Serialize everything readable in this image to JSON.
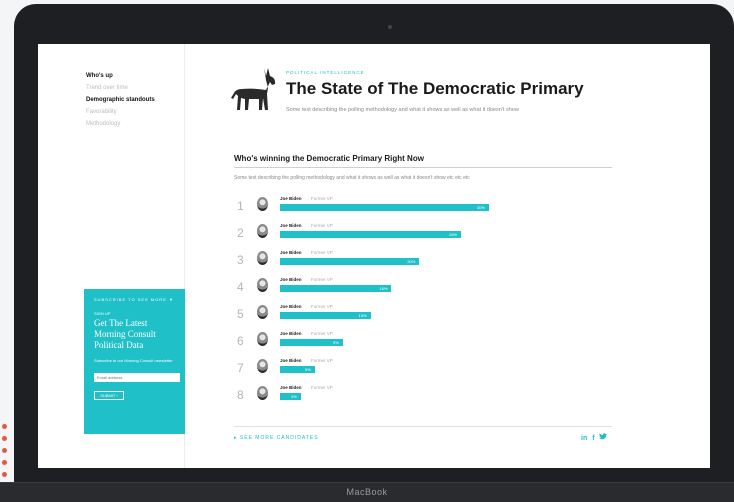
{
  "device": {
    "brand_label": "MacBook"
  },
  "sidebar": {
    "nav_items": [
      {
        "label": "Who's up",
        "active": true
      },
      {
        "label": "Trend over time",
        "active": false
      },
      {
        "label": "Demographic standouts",
        "active": true
      },
      {
        "label": "Favorability",
        "active": false
      },
      {
        "label": "Methodology",
        "active": false
      }
    ],
    "promo": {
      "heading": "SUBSCRIBE TO SEE MORE ▼",
      "kicker": "SIGN UP",
      "title": "Get The Latest Morning Consult Political Data",
      "hint": "Subscribe to our Morning Consult newsletter",
      "input_placeholder": "Email address",
      "button_label": "SUBMIT ›"
    }
  },
  "header": {
    "eyebrow": "POLITICAL INTELLIGENCE",
    "title": "The State of The Democratic Primary",
    "subtitle": "Some text describing the polling methodology and what it shows as well as what it doesn't show",
    "icon": "donkey-icon"
  },
  "section": {
    "title": "Who's winning the Democratic Primary Right Now",
    "description": "Some text describing the polling methodology and what it shows as well as what it doesn't show etc etc etc"
  },
  "accent_color": "#1fc0c7",
  "chart_data": {
    "type": "bar",
    "orientation": "horizontal",
    "categories": [
      "Joe Biden",
      "Joe Biden",
      "Joe Biden",
      "Joe Biden",
      "Joe Biden",
      "Joe Biden",
      "Joe Biden",
      "Joe Biden"
    ],
    "candidates": [
      {
        "rank": "1",
        "name": "Joe Biden",
        "role": "Former VP",
        "value": 30,
        "label": "30%"
      },
      {
        "rank": "2",
        "name": "Joe Biden",
        "role": "Former VP",
        "value": 26,
        "label": "26%"
      },
      {
        "rank": "3",
        "name": "Joe Biden",
        "role": "Former VP",
        "value": 20,
        "label": "20%"
      },
      {
        "rank": "4",
        "name": "Joe Biden",
        "role": "Former VP",
        "value": 16,
        "label": "16%"
      },
      {
        "rank": "5",
        "name": "Joe Biden",
        "role": "Former VP",
        "value": 13,
        "label": "13%"
      },
      {
        "rank": "6",
        "name": "Joe Biden",
        "role": "Former VP",
        "value": 9,
        "label": "9%"
      },
      {
        "rank": "7",
        "name": "Joe Biden",
        "role": "Former VP",
        "value": 5,
        "label": "5%"
      },
      {
        "rank": "8",
        "name": "Joe Biden",
        "role": "Former VP",
        "value": 3,
        "label": "3%"
      }
    ],
    "xlim": [
      0,
      30
    ]
  },
  "footer": {
    "see_more": "SEE MORE CANDIDATES",
    "social": [
      "in",
      "f",
      "twitter-icon"
    ]
  }
}
